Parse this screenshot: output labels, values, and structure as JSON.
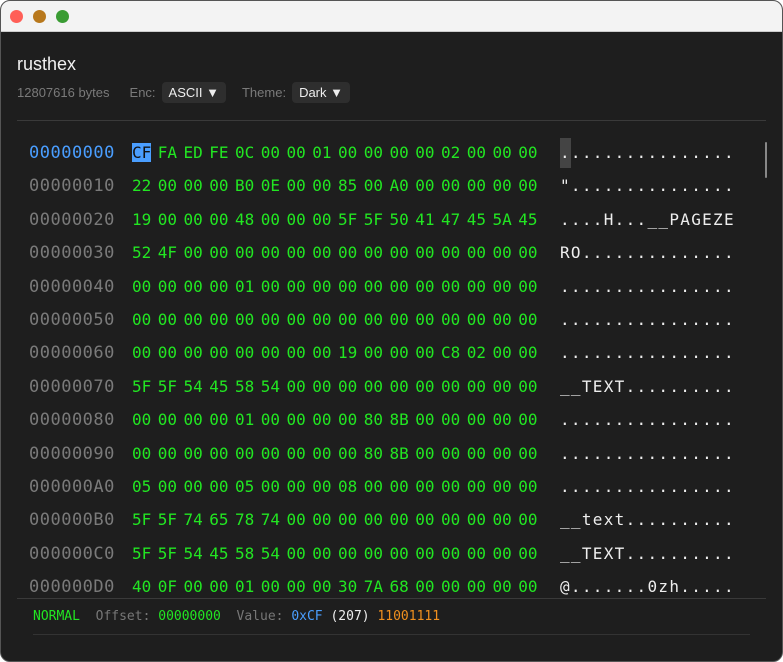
{
  "window": {
    "title": "rusthex"
  },
  "info": {
    "size": "12807616 bytes",
    "enc_label": "Enc:",
    "enc_value": "ASCII ▼",
    "theme_label": "Theme:",
    "theme_value": "Dark ▼"
  },
  "rows": [
    {
      "offset": "00000000",
      "hex": [
        "CF",
        "FA",
        "ED",
        "FE",
        "0C",
        "00",
        "00",
        "01",
        "00",
        "00",
        "00",
        "00",
        "02",
        "00",
        "00",
        "00"
      ],
      "ascii": "................"
    },
    {
      "offset": "00000010",
      "hex": [
        "22",
        "00",
        "00",
        "00",
        "B0",
        "0E",
        "00",
        "00",
        "85",
        "00",
        "A0",
        "00",
        "00",
        "00",
        "00",
        "00"
      ],
      "ascii": "\"..............."
    },
    {
      "offset": "00000020",
      "hex": [
        "19",
        "00",
        "00",
        "00",
        "48",
        "00",
        "00",
        "00",
        "5F",
        "5F",
        "50",
        "41",
        "47",
        "45",
        "5A",
        "45"
      ],
      "ascii": "....H...__PAGEZE"
    },
    {
      "offset": "00000030",
      "hex": [
        "52",
        "4F",
        "00",
        "00",
        "00",
        "00",
        "00",
        "00",
        "00",
        "00",
        "00",
        "00",
        "00",
        "00",
        "00",
        "00"
      ],
      "ascii": "RO.............."
    },
    {
      "offset": "00000040",
      "hex": [
        "00",
        "00",
        "00",
        "00",
        "01",
        "00",
        "00",
        "00",
        "00",
        "00",
        "00",
        "00",
        "00",
        "00",
        "00",
        "00"
      ],
      "ascii": "................"
    },
    {
      "offset": "00000050",
      "hex": [
        "00",
        "00",
        "00",
        "00",
        "00",
        "00",
        "00",
        "00",
        "00",
        "00",
        "00",
        "00",
        "00",
        "00",
        "00",
        "00"
      ],
      "ascii": "................"
    },
    {
      "offset": "00000060",
      "hex": [
        "00",
        "00",
        "00",
        "00",
        "00",
        "00",
        "00",
        "00",
        "19",
        "00",
        "00",
        "00",
        "C8",
        "02",
        "00",
        "00"
      ],
      "ascii": "................"
    },
    {
      "offset": "00000070",
      "hex": [
        "5F",
        "5F",
        "54",
        "45",
        "58",
        "54",
        "00",
        "00",
        "00",
        "00",
        "00",
        "00",
        "00",
        "00",
        "00",
        "00"
      ],
      "ascii": "__TEXT.........."
    },
    {
      "offset": "00000080",
      "hex": [
        "00",
        "00",
        "00",
        "00",
        "01",
        "00",
        "00",
        "00",
        "00",
        "80",
        "8B",
        "00",
        "00",
        "00",
        "00",
        "00"
      ],
      "ascii": "................"
    },
    {
      "offset": "00000090",
      "hex": [
        "00",
        "00",
        "00",
        "00",
        "00",
        "00",
        "00",
        "00",
        "00",
        "80",
        "8B",
        "00",
        "00",
        "00",
        "00",
        "00"
      ],
      "ascii": "................"
    },
    {
      "offset": "000000A0",
      "hex": [
        "05",
        "00",
        "00",
        "00",
        "05",
        "00",
        "00",
        "00",
        "08",
        "00",
        "00",
        "00",
        "00",
        "00",
        "00",
        "00"
      ],
      "ascii": "................"
    },
    {
      "offset": "000000B0",
      "hex": [
        "5F",
        "5F",
        "74",
        "65",
        "78",
        "74",
        "00",
        "00",
        "00",
        "00",
        "00",
        "00",
        "00",
        "00",
        "00",
        "00"
      ],
      "ascii": "__text.........."
    },
    {
      "offset": "000000C0",
      "hex": [
        "5F",
        "5F",
        "54",
        "45",
        "58",
        "54",
        "00",
        "00",
        "00",
        "00",
        "00",
        "00",
        "00",
        "00",
        "00",
        "00"
      ],
      "ascii": "__TEXT.........."
    },
    {
      "offset": "000000D0",
      "hex": [
        "40",
        "0F",
        "00",
        "00",
        "01",
        "00",
        "00",
        "00",
        "30",
        "7A",
        "68",
        "00",
        "00",
        "00",
        "00",
        "00"
      ],
      "ascii": "@.......0zh....."
    }
  ],
  "status": {
    "mode": "NORMAL",
    "offset_label": "Offset:",
    "offset": "00000000",
    "value_label": "Value:",
    "hex": "0xCF",
    "dec": "(207)",
    "bin": "11001111"
  },
  "colors": {
    "hex": "#22e622",
    "offset_active": "#4a9eff",
    "binary": "#f0901e"
  }
}
